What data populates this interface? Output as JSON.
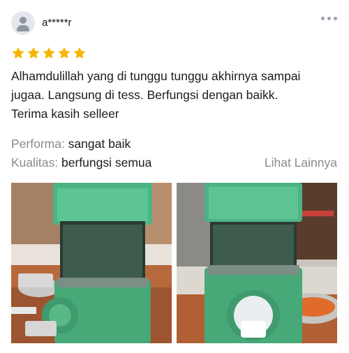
{
  "review": {
    "username": "a*****r",
    "rating": 5,
    "max_rating": 5,
    "text_lines": [
      "Alhamdulillah yang di tunggu tunggu akhirnya sampai",
      "jugaa. Langsung di tess. Berfungsi dengan baikk.",
      "Terima kasih selleer"
    ],
    "attributes": [
      {
        "key": "Performa:",
        "value": "sangat baik"
      },
      {
        "key": "Kualitas:",
        "value": "berfungsi semua"
      }
    ],
    "see_more_label": "Lihat Lainnya",
    "photos": [
      {
        "subject": "green rotary grater on wooden table"
      },
      {
        "subject": "green rotary grater with grated carrot bowl"
      }
    ]
  },
  "icons": {
    "avatar": "user-avatar-icon",
    "more": "more-options-icon",
    "star": "star-icon"
  },
  "colors": {
    "star": "#f7b500",
    "muted_text": "#8a8a8a",
    "body_text": "#1c1c1c",
    "grater_green": "#4caf7a"
  }
}
